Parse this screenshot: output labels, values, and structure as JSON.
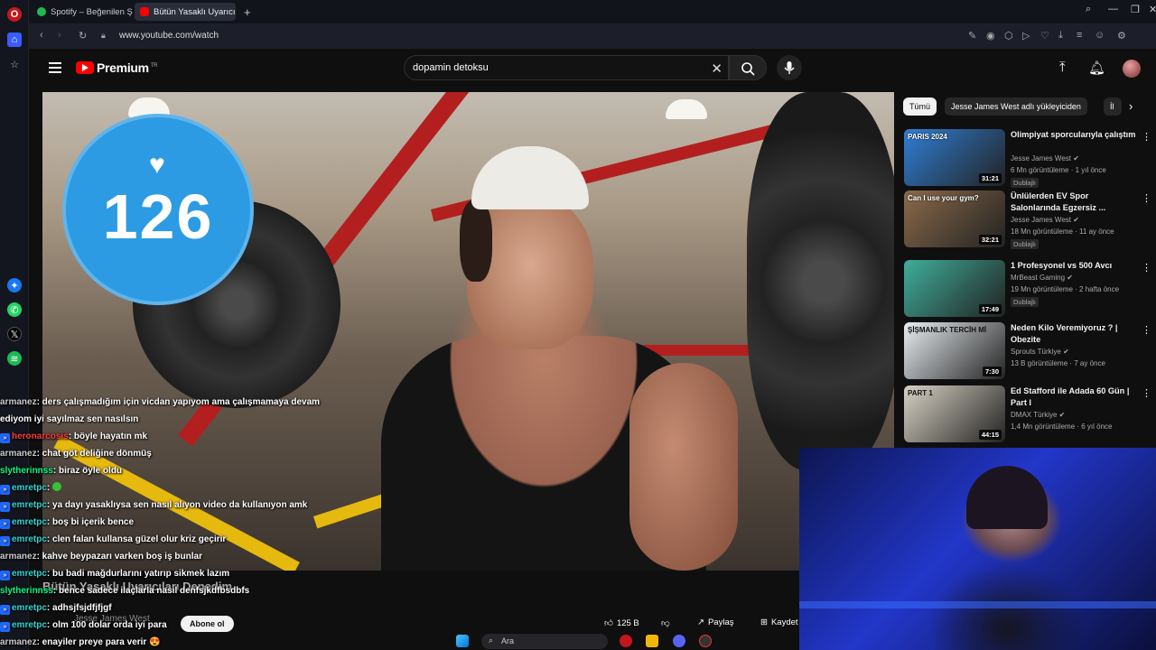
{
  "browser": {
    "tabs": [
      {
        "label": "Spotify – Beğenilen Şarkılar",
        "active": false
      },
      {
        "label": "Bütün Yasaklı Uyarıcılar",
        "active": true
      }
    ],
    "new_tab": "+",
    "url": "www.youtube.com/watch"
  },
  "youtube": {
    "brand": "Premium",
    "brand_sup": "TR",
    "search_value": "dopamin detoksu"
  },
  "video": {
    "counter_value": "126",
    "title": "Bütün Yasaklı Uyarıcıları Denedim",
    "channel": "Jesse James West",
    "subscribe_label": "Abone ol",
    "likes": "125 B",
    "share_label": "Paylaş",
    "save_label": "Kaydet"
  },
  "chips": [
    {
      "label": "Tümü",
      "selected": true
    },
    {
      "label": "Jesse James West adlı yükleyiciden",
      "selected": false
    },
    {
      "label": "İl",
      "selected": false
    }
  ],
  "recommendations": [
    {
      "title": "Olimpiyat sporcularıyla çalıştım",
      "channel": "Jesse James West",
      "meta": "6 Mn görüntüleme · 1 yıl önce",
      "badge": "Dublajlı",
      "duration": "31:21",
      "thumb_text": "PARIS 2024",
      "thumb_color": "#2f7fd6"
    },
    {
      "title": "Ünlülerden EV Spor Salonlarında Egzersiz ...",
      "channel": "Jesse James West",
      "meta": "18 Mn görüntüleme · 11 ay önce",
      "badge": "Dublajlı",
      "duration": "32:21",
      "thumb_text": "Can I use your gym?",
      "thumb_color": "#8a6a4a"
    },
    {
      "title": "1 Profesyonel vs 500 Avcı",
      "channel": "MrBeast Gaming",
      "meta": "19 Mn görüntüleme · 2 hafta önce",
      "badge": "Dublajlı",
      "duration": "17:49",
      "thumb_text": "",
      "thumb_color": "#3fae9a"
    },
    {
      "title": "Neden Kilo Veremiyoruz ? | Obezite",
      "channel": "Sprouts Türkiye",
      "meta": "13 B görüntüleme · 7 ay önce",
      "badge": "",
      "duration": "7:30",
      "thumb_text": "ŞİŞMANLIK TERCİH Mİ",
      "thumb_color": "#e9eef2"
    },
    {
      "title": "Ed Stafford ile Adada 60 Gün | Part I",
      "channel": "DMAX Türkiye",
      "meta": "1,4 Mn görüntüleme · 6 yıl önce",
      "badge": "",
      "duration": "44:15",
      "thumb_text": "PART 1",
      "thumb_color": "#d8d2c4"
    }
  ],
  "chat": [
    {
      "user": "armanez",
      "badge": false,
      "color": "arm",
      "text": ": ders çalışmadığım için vicdan yapıyom ama çalışmamaya devam"
    },
    {
      "user": "",
      "badge": false,
      "color": "arm",
      "text": "ediyom iyi sayılmaz sen nasılsın"
    },
    {
      "user": "heronarcosis",
      "badge": true,
      "color": "red",
      "text": ": böyle hayatın mk"
    },
    {
      "user": "armanez",
      "badge": false,
      "color": "arm",
      "text": ": chat göt deliğine dönmüş"
    },
    {
      "user": "slytherinnss",
      "badge": false,
      "color": "sly",
      "text": ": biraz öyle oldu"
    },
    {
      "user": "emretpc",
      "badge": true,
      "color": "emr",
      "text": ":"
    },
    {
      "user": "emretpc",
      "badge": true,
      "color": "emr",
      "text": ": ya dayı yasaklıysa sen nasıl alıyon video da kullanıyon amk"
    },
    {
      "user": "emretpc",
      "badge": true,
      "color": "emr",
      "text": ": boş bi içerik bence"
    },
    {
      "user": "emretpc",
      "badge": true,
      "color": "emr",
      "text": ": clen falan kullansa güzel olur kriz geçirir"
    },
    {
      "user": "armanez",
      "badge": false,
      "color": "arm",
      "text": ": kahve beypazarı varken boş iş bunlar"
    },
    {
      "user": "emretpc",
      "badge": true,
      "color": "emr",
      "text": ": bu badi mağdurlarını yatırıp sikmek lazım"
    },
    {
      "user": "slytherinnss",
      "badge": false,
      "color": "sly",
      "text": ": bence sadece ilaçlarla nasıl denfsjkdfbsdbfs"
    },
    {
      "user": "emretpc",
      "badge": true,
      "color": "emr",
      "text": ": adhsjfsjdfjfjgf"
    },
    {
      "user": "emretpc",
      "badge": true,
      "color": "emr",
      "text": ": olm 100 dolar orda iyi para"
    },
    {
      "user": "armanez",
      "badge": false,
      "color": "arm",
      "text": ": enayiler preye para verir"
    }
  ],
  "taskbar": {
    "search_label": "Ara"
  },
  "icons": {
    "back": "back-icon",
    "forward": "forward-icon",
    "reload": "reload-icon",
    "search": "search-icon",
    "mic": "mic-icon",
    "upload": "upload-icon",
    "bell": "bell-icon",
    "close": "close-icon"
  }
}
